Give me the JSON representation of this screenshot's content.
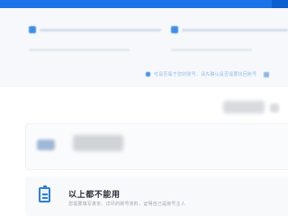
{
  "header": {
    "link_text": "可是否属于您的账号，请先确认是否需要找回账号"
  },
  "options": {
    "none_available_title": "以上都不能用",
    "none_available_desc": "您需要填写真实、详尽的账号资料，证明自己是账号主人"
  },
  "colors": {
    "brand": "#1a73e8",
    "link": "#7aa6dd",
    "title_text": "#2a2f3a"
  }
}
